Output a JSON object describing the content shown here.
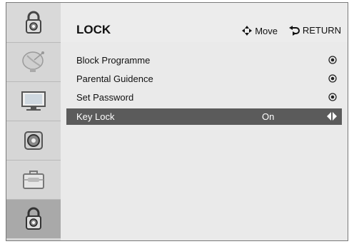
{
  "header": {
    "title": "LOCK",
    "hints": [
      {
        "icon": "four-way-arrow-icon",
        "label": "Move"
      },
      {
        "icon": "return-arrow-icon",
        "label": "RETURN"
      }
    ]
  },
  "sidebar": {
    "items": [
      {
        "icon": "satellite-dish-icon",
        "active": false
      },
      {
        "icon": "monitor-icon",
        "active": false
      },
      {
        "icon": "speaker-icon",
        "active": false
      },
      {
        "icon": "toolbox-icon",
        "active": false
      },
      {
        "icon": "padlock-icon",
        "active": true
      }
    ]
  },
  "menu": {
    "items": [
      {
        "label": "Block Programme",
        "value": "",
        "indicator": "enter-dot-icon"
      },
      {
        "label": "Parental Guidence",
        "value": "",
        "indicator": "enter-dot-icon"
      },
      {
        "label": "Set Password",
        "value": "",
        "indicator": "enter-dot-icon"
      },
      {
        "label": "Key Lock",
        "value": "On",
        "indicator": "left-right-arrows-icon",
        "selected": true
      }
    ]
  },
  "colors": {
    "selected_row": "#5b5b5b",
    "active_sidebar": "#a9a9a9",
    "background": "#eaeaea"
  }
}
